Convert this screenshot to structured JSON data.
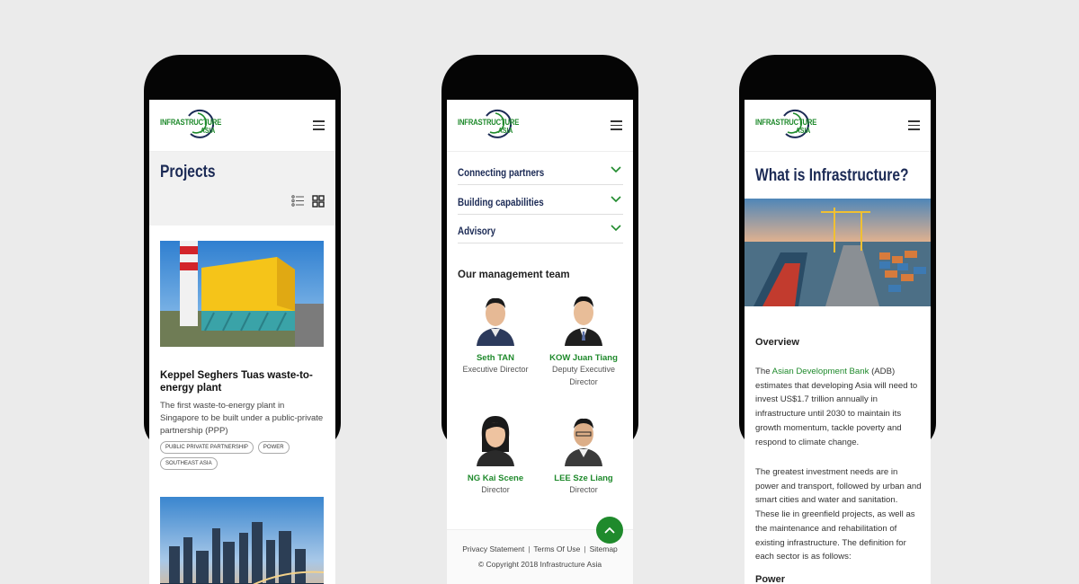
{
  "brand": {
    "logo_line1": "INFRASTRUCTURE",
    "logo_line2": "ASIA",
    "green": "#1f8a2c",
    "navy": "#1b2a55"
  },
  "icons": {
    "menu": "hamburger-icon",
    "list_view": "list-view-icon",
    "grid_view": "grid-view-icon",
    "chevron": "chevron-down-icon",
    "back_to_top": "chevron-up-icon"
  },
  "projects_page": {
    "title": "Projects",
    "project": {
      "title": "Keppel Seghers Tuas waste-to-energy plant",
      "description": "The first waste-to-energy plant in Singapore to be built under a public-private partnership (PPP)",
      "tags": [
        "PUBLIC PRIVATE PARTNERSHIP",
        "POWER",
        "SOUTHEAST ASIA"
      ]
    }
  },
  "about_page": {
    "accordion": [
      "Connecting partners",
      "Building capabilities",
      "Advisory"
    ],
    "management_title": "Our management team",
    "team": [
      {
        "name": "Seth TAN",
        "role": "Executive Director"
      },
      {
        "name": "KOW Juan Tiang",
        "role": "Deputy Executive Director"
      },
      {
        "name": "NG Kai Scene",
        "role": "Director"
      },
      {
        "name": "LEE Sze Liang",
        "role": "Director"
      }
    ],
    "footer": {
      "links": [
        "Privacy Statement",
        "Terms Of Use",
        "Sitemap"
      ],
      "copyright": "© Copyright 2018 Infrastructure Asia"
    }
  },
  "infra_page": {
    "title": "What is Infrastructure?",
    "overview_heading": "Overview",
    "para1_pre": "The ",
    "para1_link": "Asian Development Bank",
    "para1_post": " (ADB) estimates that developing Asia will need to invest US$1.7 trillion annually in infrastructure until 2030 to maintain its growth momentum, tackle poverty and respond to climate change.",
    "para2": "The greatest investment needs are in power and transport, followed by urban and smart cities and water and sanitation. These lie in greenfield projects, as well as the maintenance and rehabilitation of existing infrastructure. The definition for each sector is as follows:",
    "power_heading": "Power"
  }
}
